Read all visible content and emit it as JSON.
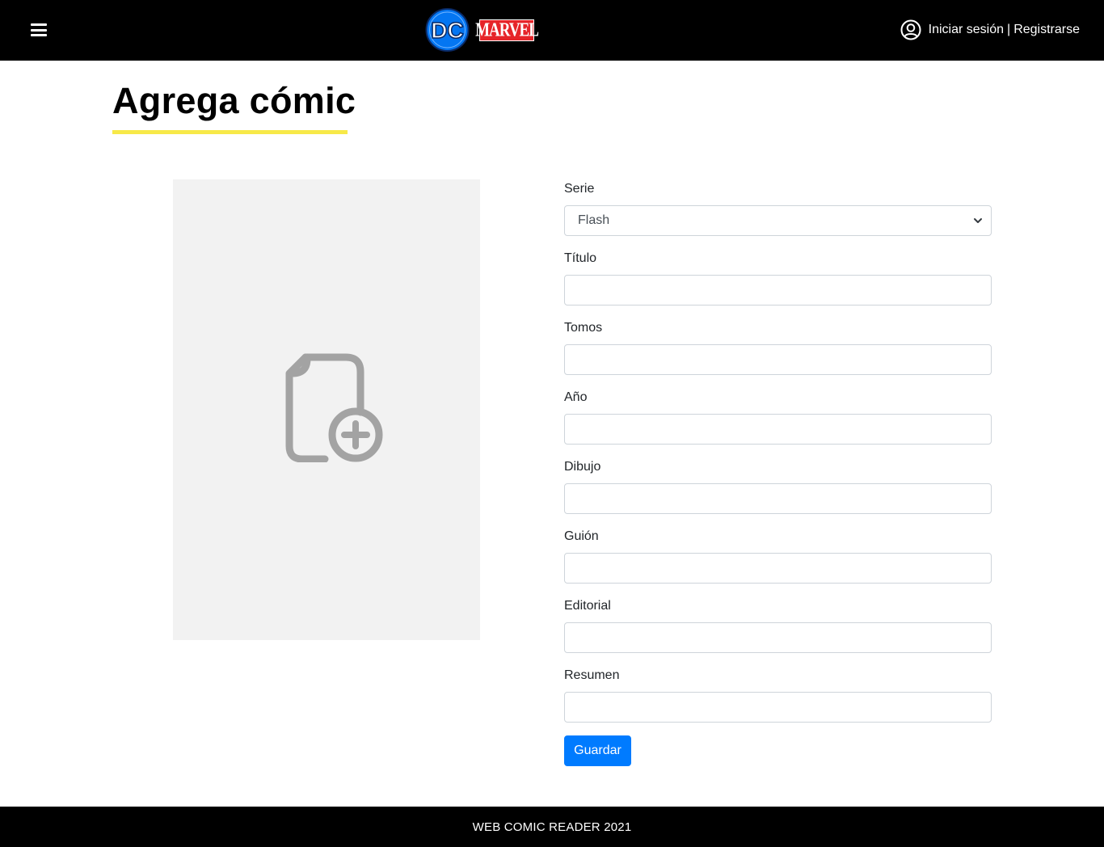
{
  "header": {
    "dc_logo_text": "DC",
    "marvel_logo_text": "MARVEL",
    "login_label": "Iniciar sesión",
    "separator": "|",
    "register_label": "Registrarse"
  },
  "page": {
    "title": "Agrega cómic"
  },
  "form": {
    "serie": {
      "label": "Serie",
      "selected": "Flash"
    },
    "titulo": {
      "label": "Título",
      "value": ""
    },
    "tomos": {
      "label": "Tomos",
      "value": ""
    },
    "anio": {
      "label": "Año",
      "value": ""
    },
    "dibujo": {
      "label": "Dibujo",
      "value": ""
    },
    "guion": {
      "label": "Guión",
      "value": ""
    },
    "editorial": {
      "label": "Editorial",
      "value": ""
    },
    "resumen": {
      "label": "Resumen",
      "value": ""
    },
    "save_label": "Guardar"
  },
  "footer": {
    "text": "WEB COMIC READER 2021"
  },
  "colors": {
    "navbar": "#000000",
    "title_underline": "#f7e948",
    "primary_button": "#007bff",
    "cover_placeholder": "#f2f2f2",
    "dc_blue": "#0476f2",
    "marvel_red": "#e62429"
  },
  "icons": {
    "menu": "hamburger-icon",
    "user": "user-circle-icon",
    "cover": "file-add-icon",
    "select": "chevron-down-icon"
  }
}
